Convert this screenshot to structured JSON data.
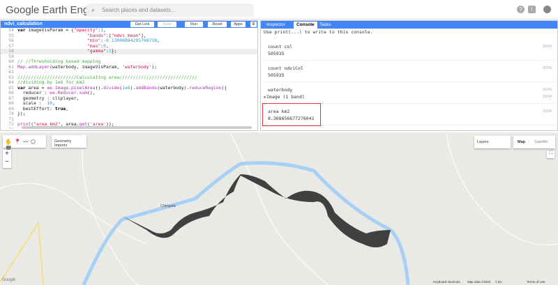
{
  "header": {
    "logo": "Google Earth Engine",
    "search_placeholder": "Search places and datasets..."
  },
  "editor": {
    "script_name": "ndvi_calculation",
    "buttons": {
      "get_link": "Get Link",
      "save": "Save",
      "run": "Run",
      "reset": "Reset",
      "apps": "Apps"
    },
    "lines": [
      {
        "n": "54",
        "seg": [
          {
            "c": "k",
            "t": "var "
          },
          {
            "c": "p",
            "t": "imageVisParam = {"
          },
          {
            "c": "s",
            "t": "\"opacity\""
          },
          {
            "c": "p",
            "t": ":"
          },
          {
            "c": "n",
            "t": "1"
          },
          {
            "c": "p",
            "t": ","
          }
        ]
      },
      {
        "n": "55",
        "seg": [
          {
            "c": "p",
            "t": "                          "
          },
          {
            "c": "s",
            "t": "\"bands\""
          },
          {
            "c": "p",
            "t": ":["
          },
          {
            "c": "s",
            "t": "\"ndvi_mean\""
          },
          {
            "c": "p",
            "t": "],"
          }
        ]
      },
      {
        "n": "56",
        "seg": [
          {
            "c": "p",
            "t": "                          "
          },
          {
            "c": "s",
            "t": "\"min\""
          },
          {
            "c": "p",
            "t": ":"
          },
          {
            "c": "n",
            "t": "-0.13006064295768738"
          },
          {
            "c": "p",
            "t": ","
          }
        ]
      },
      {
        "n": "57",
        "seg": [
          {
            "c": "p",
            "t": "                          "
          },
          {
            "c": "s",
            "t": "\"max\""
          },
          {
            "c": "p",
            "t": ":"
          },
          {
            "c": "n",
            "t": "0"
          },
          {
            "c": "p",
            "t": ","
          }
        ]
      },
      {
        "n": "58",
        "seg": [
          {
            "c": "p",
            "t": "                          "
          },
          {
            "c": "s",
            "t": "\"gamma\""
          },
          {
            "c": "p",
            "t": ":"
          },
          {
            "c": "n",
            "t": "1"
          },
          {
            "c": "p",
            "t": "};"
          }
        ]
      },
      {
        "n": "59",
        "seg": []
      },
      {
        "n": "60",
        "seg": [
          {
            "c": "c",
            "t": "// //Thresholding based mapping"
          }
        ]
      },
      {
        "n": "61",
        "seg": [
          {
            "c": "f",
            "t": "Map.addLayer"
          },
          {
            "c": "p",
            "t": "(waterbody, imageVisParam, "
          },
          {
            "c": "s",
            "t": "'waterbody'"
          },
          {
            "c": "p",
            "t": ");"
          }
        ]
      },
      {
        "n": "62",
        "seg": []
      },
      {
        "n": "63",
        "seg": [
          {
            "c": "c",
            "t": "//////////////////////Calculating area/////////////////////////////"
          }
        ]
      },
      {
        "n": "64",
        "seg": [
          {
            "c": "c",
            "t": "//dividing by 1e6 for km2"
          }
        ]
      },
      {
        "n": "65",
        "seg": [
          {
            "c": "k",
            "t": "var "
          },
          {
            "c": "p",
            "t": "area = "
          },
          {
            "c": "f",
            "t": "ee.Image.pixelArea"
          },
          {
            "c": "p",
            "t": "()."
          },
          {
            "c": "f",
            "t": "divide"
          },
          {
            "c": "p",
            "t": "("
          },
          {
            "c": "n",
            "t": "1e6"
          },
          {
            "c": "p",
            "t": ")."
          },
          {
            "c": "f",
            "t": "addBands"
          },
          {
            "c": "p",
            "t": "(waterbody)."
          },
          {
            "c": "f",
            "t": "reduceRegion"
          },
          {
            "c": "p",
            "t": "({"
          }
        ]
      },
      {
        "n": "66",
        "seg": [
          {
            "c": "p",
            "t": "  reducer : "
          },
          {
            "c": "f",
            "t": "ee.Reducer.sum"
          },
          {
            "c": "p",
            "t": "(),"
          }
        ]
      },
      {
        "n": "67",
        "seg": [
          {
            "c": "p",
            "t": "  geometry : cliplayer,"
          }
        ]
      },
      {
        "n": "68",
        "seg": [
          {
            "c": "p",
            "t": "  scale :  "
          },
          {
            "c": "n",
            "t": "10"
          },
          {
            "c": "p",
            "t": ","
          }
        ]
      },
      {
        "n": "69",
        "seg": [
          {
            "c": "p",
            "t": "  bestEffort: "
          },
          {
            "c": "k",
            "t": "true"
          },
          {
            "c": "p",
            "t": ","
          }
        ]
      },
      {
        "n": "70",
        "seg": [
          {
            "c": "p",
            "t": "});"
          }
        ]
      },
      {
        "n": "71",
        "seg": []
      },
      {
        "n": "72",
        "seg": [
          {
            "c": "f",
            "t": "print"
          },
          {
            "c": "p",
            "t": "("
          },
          {
            "c": "s",
            "t": "\"area km2\""
          },
          {
            "c": "p",
            "t": ", area."
          },
          {
            "c": "f",
            "t": "get"
          },
          {
            "c": "p",
            "t": "("
          },
          {
            "c": "s",
            "t": "'area'"
          },
          {
            "c": "p",
            "t": "));"
          }
        ]
      },
      {
        "n": "73",
        "seg": []
      }
    ]
  },
  "console": {
    "tabs": [
      "Inspector",
      "Console",
      "Tasks"
    ],
    "active_tab": "Console",
    "hint": "Use print(...) to write to this console.",
    "json_label": "JSON",
    "entries": [
      {
        "label": "count col",
        "value": "505935"
      },
      {
        "label": "count ndviCol",
        "value": "505935"
      },
      {
        "label": "waterbody",
        "value": "Image (1 band)"
      },
      {
        "label": "area km2",
        "value": "8.368656677276041"
      }
    ]
  },
  "map": {
    "geometry_imports": "Geometry Imports",
    "layers": "Layers",
    "map_type": "Map",
    "satellite": "Satellite",
    "active_map_type": "Map",
    "zoom_in": "+",
    "zoom_out": "−",
    "place_label": "Chingala",
    "attribution": {
      "shortcuts": "Keyboard shortcuts",
      "data": "Map data ©2022",
      "scale": "1 km",
      "terms": "Terms of Use"
    },
    "google": "Google"
  },
  "colors": {
    "accent": "#4285f4",
    "water": "#a8d0f5",
    "highlight": "#d33333"
  }
}
